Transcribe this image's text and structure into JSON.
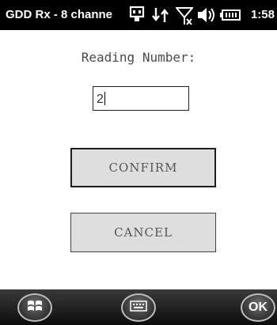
{
  "status_bar": {
    "app_title": "GDD Rx - 8 channe",
    "time": "1:58",
    "icons": [
      "connection-icon",
      "sync-icon",
      "signal-off-icon",
      "volume-icon",
      "battery-icon"
    ]
  },
  "form": {
    "label": "Reading Number:",
    "input_value": "2",
    "confirm_label": "CONFIRM",
    "cancel_label": "CANCEL"
  },
  "bottom_bar": {
    "ok_label": "OK",
    "icons": [
      "windows-start-icon",
      "keyboard-icon",
      "ok-icon"
    ]
  }
}
